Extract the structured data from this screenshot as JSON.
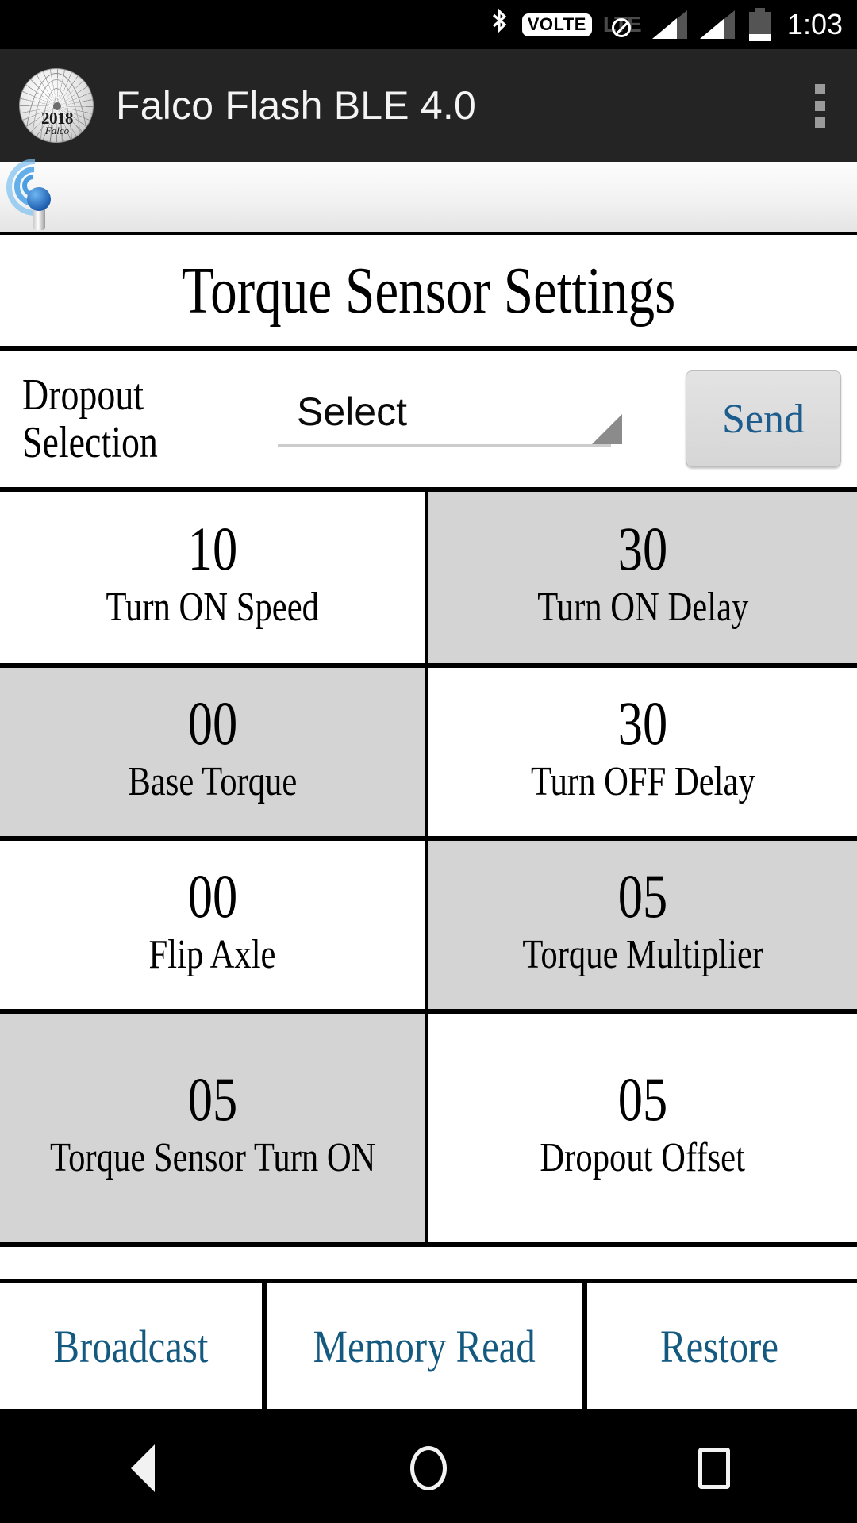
{
  "status_bar": {
    "bluetooth_icon": "bluetooth-icon",
    "volte_badge": "VOLTE",
    "network_type": "LTE",
    "network_slash_icon": "no-data-slash-icon",
    "signal_bars_icon": "signal-bars-icon",
    "battery_icon": "battery-low-icon",
    "time": "1:03"
  },
  "app_bar": {
    "logo_year": "2018",
    "logo_brand": "Falco",
    "title": "Falco Flash BLE 4.0",
    "overflow_icon": "overflow-menu-icon"
  },
  "ble_strip": {
    "icon": "bluetooth-broadcast-icon"
  },
  "page": {
    "title": "Torque Sensor Settings"
  },
  "dropout": {
    "label_line1": "Dropout",
    "label_line2": "Selection",
    "spinner_value": "Select",
    "spinner_arrow_icon": "dropdown-arrow-icon",
    "send_label": "Send"
  },
  "settings_grid": {
    "rows": [
      [
        {
          "value": "10",
          "label": "Turn ON Speed",
          "shade": "white"
        },
        {
          "value": "30",
          "label": "Turn ON Delay",
          "shade": "gray"
        }
      ],
      [
        {
          "value": "00",
          "label": "Base Torque",
          "shade": "gray"
        },
        {
          "value": "30",
          "label": "Turn OFF Delay",
          "shade": "white"
        }
      ],
      [
        {
          "value": "00",
          "label": "Flip Axle",
          "shade": "white"
        },
        {
          "value": "05",
          "label": "Torque Multiplier",
          "shade": "gray"
        }
      ],
      [
        {
          "value": "05",
          "label": "Torque Sensor Turn ON",
          "shade": "gray"
        },
        {
          "value": "05",
          "label": "Dropout Offset",
          "shade": "white"
        }
      ]
    ]
  },
  "actions": {
    "broadcast": "Broadcast",
    "memory_read": "Memory Read",
    "restore": "Restore"
  },
  "nav_bar": {
    "back_icon": "back-triangle-icon",
    "home_icon": "home-circle-icon",
    "recents_icon": "recents-square-icon"
  },
  "colors": {
    "accent_blue": "#145a80",
    "send_blue": "#1c5d8e",
    "appbar_bg": "#242424",
    "cell_gray": "#d4d4d4"
  }
}
